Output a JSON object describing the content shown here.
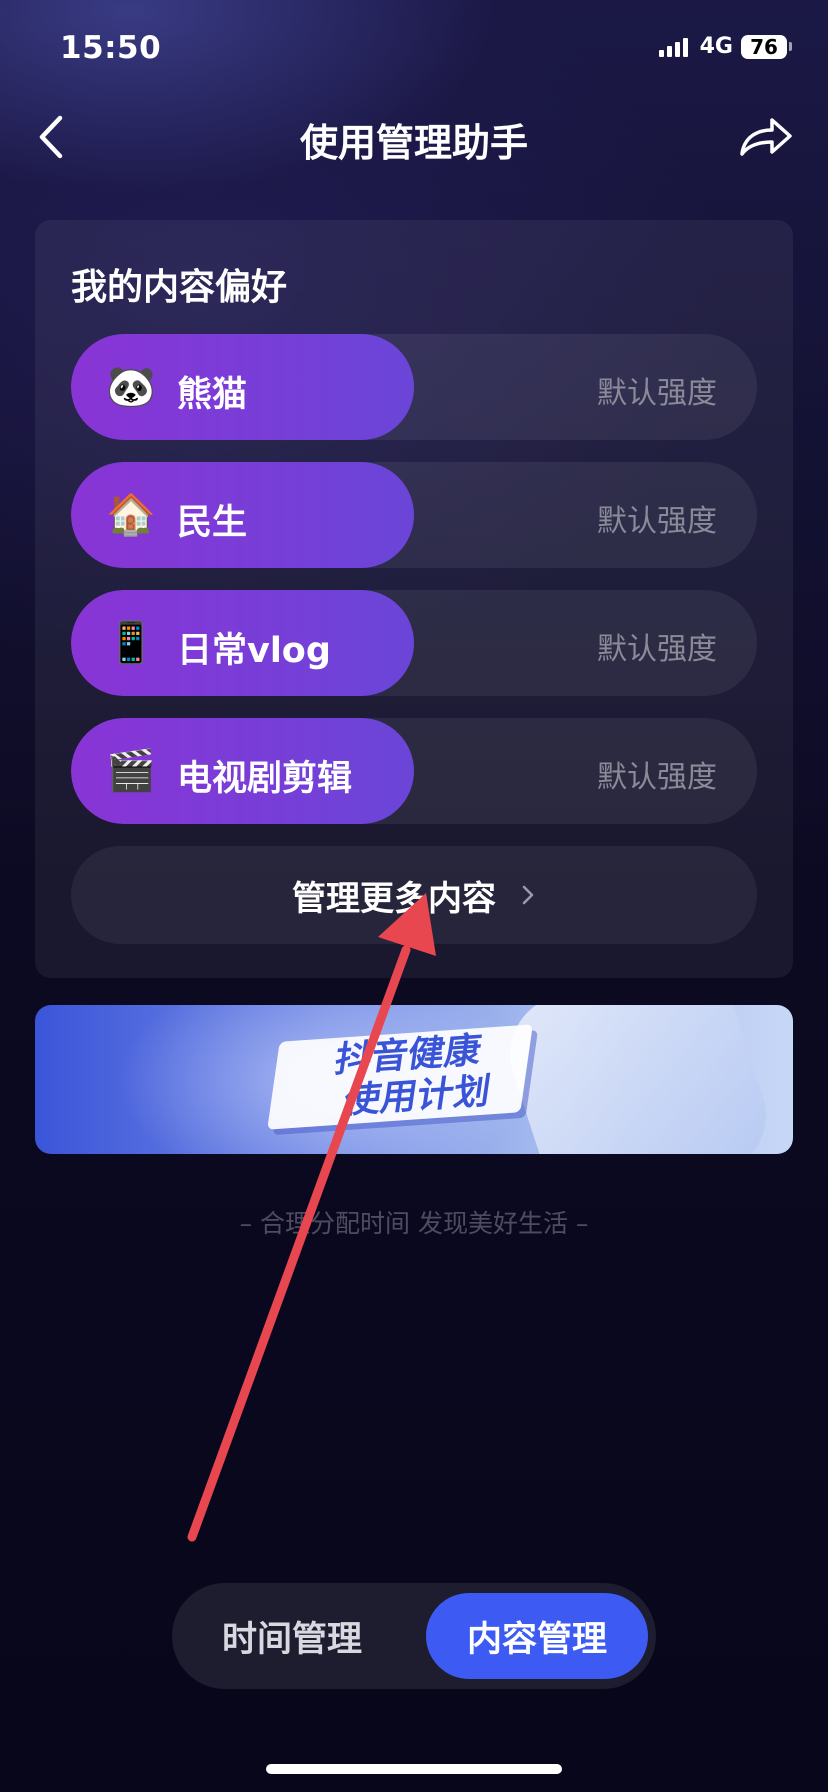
{
  "status_bar": {
    "time": "15:50",
    "network": "4G",
    "battery": "76"
  },
  "header": {
    "title": "使用管理助手",
    "back_icon": "chevron-left-icon",
    "share_icon": "share-arrow-icon"
  },
  "preferences": {
    "title": "我的内容偏好",
    "items": [
      {
        "emoji": "🐼",
        "label": "熊猫",
        "strength": "默认强度"
      },
      {
        "emoji": "🏠",
        "label": "民生",
        "strength": "默认强度"
      },
      {
        "emoji": "📱",
        "label": "日常vlog",
        "strength": "默认强度"
      },
      {
        "emoji": "🎬",
        "label": "电视剧剪辑",
        "strength": "默认强度"
      }
    ],
    "manage_more": "管理更多内容"
  },
  "banner": {
    "line1": "抖音健康",
    "line2": "使用计划"
  },
  "slogan": "– 合理分配时间 发现美好生活 –",
  "bottom_tabs": {
    "time": "时间管理",
    "content": "内容管理",
    "active": "内容管理"
  },
  "colors": {
    "accent_blue": "#3d5bf2",
    "pref_purple": "#8a34d6",
    "annotation_red": "#e8474f"
  }
}
